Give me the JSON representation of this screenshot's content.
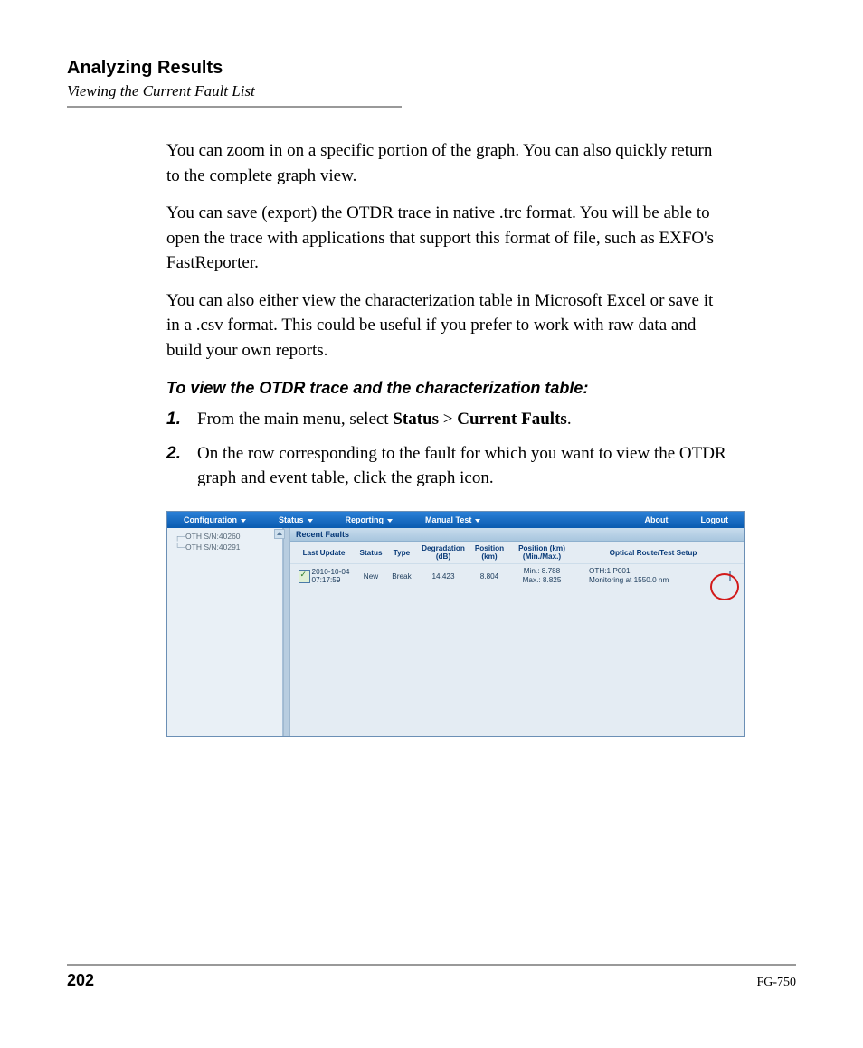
{
  "header": {
    "title": "Analyzing Results",
    "subtitle": "Viewing the Current Fault List"
  },
  "paragraphs": {
    "p1": "You can zoom in on a specific portion of the graph. You can also quickly return to the complete graph view.",
    "p2": "You can save (export) the OTDR trace in native .trc format. You will be able to open the trace with applications that support this format of file, such as EXFO's FastReporter.",
    "p3": "You can also either view the characterization table in Microsoft Excel or save it in a .csv format. This could be useful if you prefer to work with raw data and build your own reports."
  },
  "instruction": "To view the OTDR trace and the characterization table:",
  "steps": {
    "s1": {
      "num": "1.",
      "pre": "From the main menu, select ",
      "b1": "Status",
      "mid": " > ",
      "b2": "Current Faults",
      "post": "."
    },
    "s2": {
      "num": "2.",
      "text": "On the row corresponding to the fault for which you want to view the OTDR graph and event table, click the graph icon."
    }
  },
  "screenshot": {
    "menu": {
      "config": "Configuration",
      "status": "Status",
      "reporting": "Reporting",
      "manual": "Manual Test",
      "about": "About",
      "logout": "Logout"
    },
    "tree": {
      "n1": "OTH S/N:40260",
      "n2": "OTH S/N:40291"
    },
    "panelTitle": "Recent Faults",
    "headers": {
      "upd": "Last Update",
      "status": "Status",
      "type": "Type",
      "deg": "Degradation (dB)",
      "pos": "Position (km)",
      "mm": "Position (km) (Min./Max.)",
      "route": "Optical Route/Test Setup"
    },
    "row": {
      "date": "2010-10-04",
      "time": "07:17:59",
      "status": "New",
      "type": "Break",
      "deg": "14.423",
      "pos": "8.804",
      "min": "Min.: 8.788",
      "max": "Max.: 8.825",
      "route1": "OTH:1 P001",
      "route2": "Monitoring at 1550.0 nm"
    }
  },
  "footer": {
    "page": "202",
    "doc": "FG-750"
  }
}
